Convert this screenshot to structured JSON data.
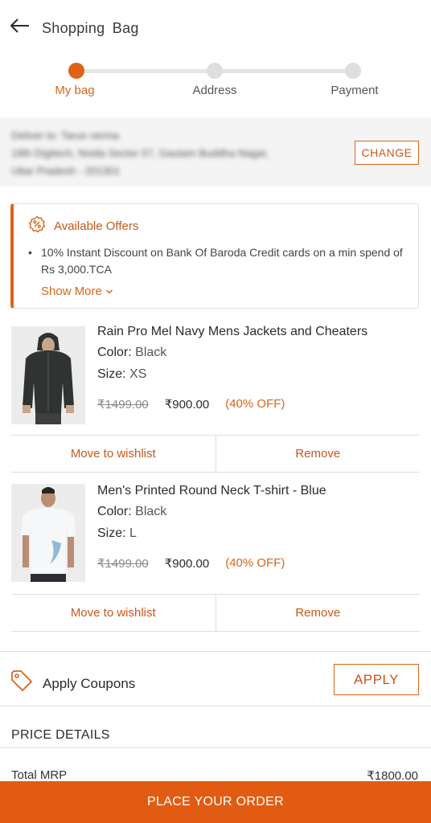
{
  "header": {
    "title": "Shopping  Bag"
  },
  "stepper": {
    "steps": [
      {
        "label": "My bag"
      },
      {
        "label": "Address"
      },
      {
        "label": "Payment"
      }
    ]
  },
  "address": {
    "line1": "Deliver to: Tarun verma",
    "line2": "18th Digitech, Noida Sector 57, Gautam Buddha Nagar,",
    "line3": "Uttar Pradesh - 201301",
    "change_label": "CHANGE"
  },
  "offers": {
    "title": "Available Offers",
    "item": "10% Instant Discount on Bank Of Baroda Credit cards on a min spend of Rs 3,000.TCA",
    "show_more": "Show More"
  },
  "products": [
    {
      "name": "Rain Pro Mel Navy Mens Jackets and Cheaters",
      "color_label": "Color:",
      "color": "Black",
      "size_label": "Size:",
      "size": "XS",
      "mrp": "₹1499.00",
      "price": "₹900.00",
      "off": "(40% OFF)",
      "wishlist_label": "Move to wishlist",
      "remove_label": "Remove"
    },
    {
      "name": "Men's Printed Round Neck T-shirt - Blue",
      "color_label": "Color:",
      "color": "Black",
      "size_label": "Size:",
      "size": "L",
      "mrp": "₹1499.00",
      "price": "₹900.00",
      "off": "(40% OFF)",
      "wishlist_label": "Move to wishlist",
      "remove_label": "Remove"
    }
  ],
  "coupons": {
    "label": "Apply Coupons",
    "apply_label": "APPLY"
  },
  "price_details": {
    "heading": "PRICE DETAILS",
    "total_mrp_label": "Total MRP",
    "total_mrp_value": "₹1800.00"
  },
  "cta": {
    "label": "PLACE YOUR ORDER"
  },
  "colors": {
    "accent": "#e25b12",
    "accent_text": "#d9641c"
  }
}
